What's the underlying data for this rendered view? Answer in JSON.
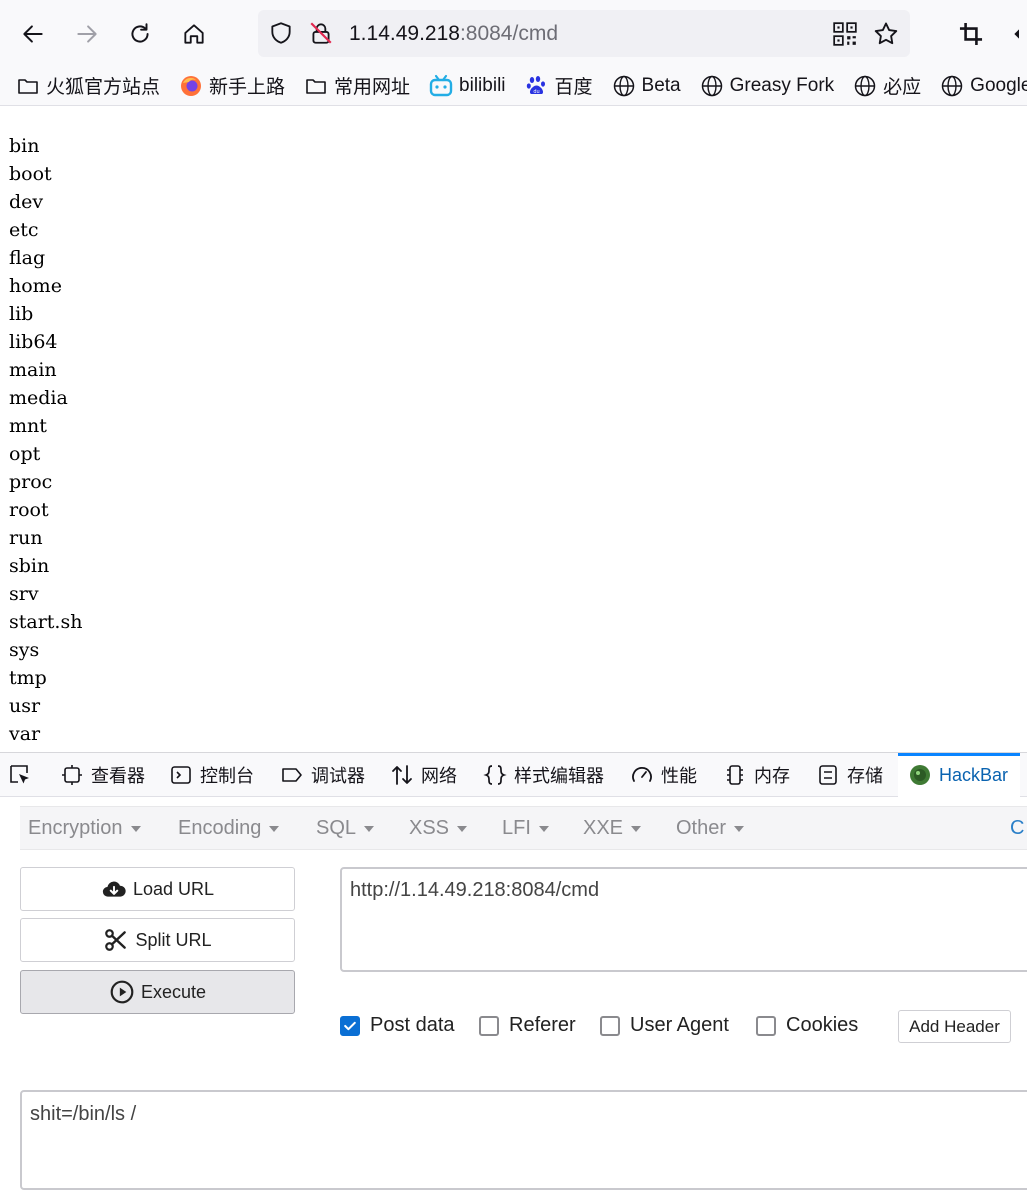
{
  "toolbar": {
    "url_host": "1.14.49.218",
    "url_rest": ":8084/cmd"
  },
  "bookmarks": [
    {
      "label": "火狐官方站点",
      "icon": "folder-icon"
    },
    {
      "label": "新手上路",
      "icon": "firefox-icon"
    },
    {
      "label": "常用网址",
      "icon": "folder-icon"
    },
    {
      "label": "bilibili",
      "icon": "bilibili-icon"
    },
    {
      "label": "百度",
      "icon": "baidu-paw-icon"
    },
    {
      "label": "Beta",
      "icon": "globe-icon"
    },
    {
      "label": "Greasy Fork",
      "icon": "globe-icon"
    },
    {
      "label": "必应",
      "icon": "globe-icon"
    },
    {
      "label": "Google",
      "icon": "globe-icon"
    }
  ],
  "listing": [
    "bin",
    "boot",
    "dev",
    "etc",
    "flag",
    "home",
    "lib",
    "lib64",
    "main",
    "media",
    "mnt",
    "opt",
    "proc",
    "root",
    "run",
    "sbin",
    "srv",
    "start.sh",
    "sys",
    "tmp",
    "usr",
    "var"
  ],
  "devtools": {
    "tabs": [
      "查看器",
      "控制台",
      "调试器",
      "网络",
      "样式编辑器",
      "性能",
      "内存",
      "存储",
      "HackBar"
    ],
    "active": "HackBar"
  },
  "hackbar": {
    "menu": [
      "Encryption",
      "Encoding",
      "SQL",
      "XSS",
      "LFI",
      "XXE",
      "Other"
    ],
    "menu_more": "C",
    "load_url": "Load URL",
    "split_url": "Split URL",
    "execute": "Execute",
    "url_value": "http://1.14.49.218:8084/cmd",
    "options": {
      "post_data": "Post data",
      "referer": "Referer",
      "user_agent": "User Agent",
      "cookies": "Cookies"
    },
    "post_data_checked": true,
    "add_header": "Add Header",
    "post_value": "shit=/bin/ls /"
  }
}
